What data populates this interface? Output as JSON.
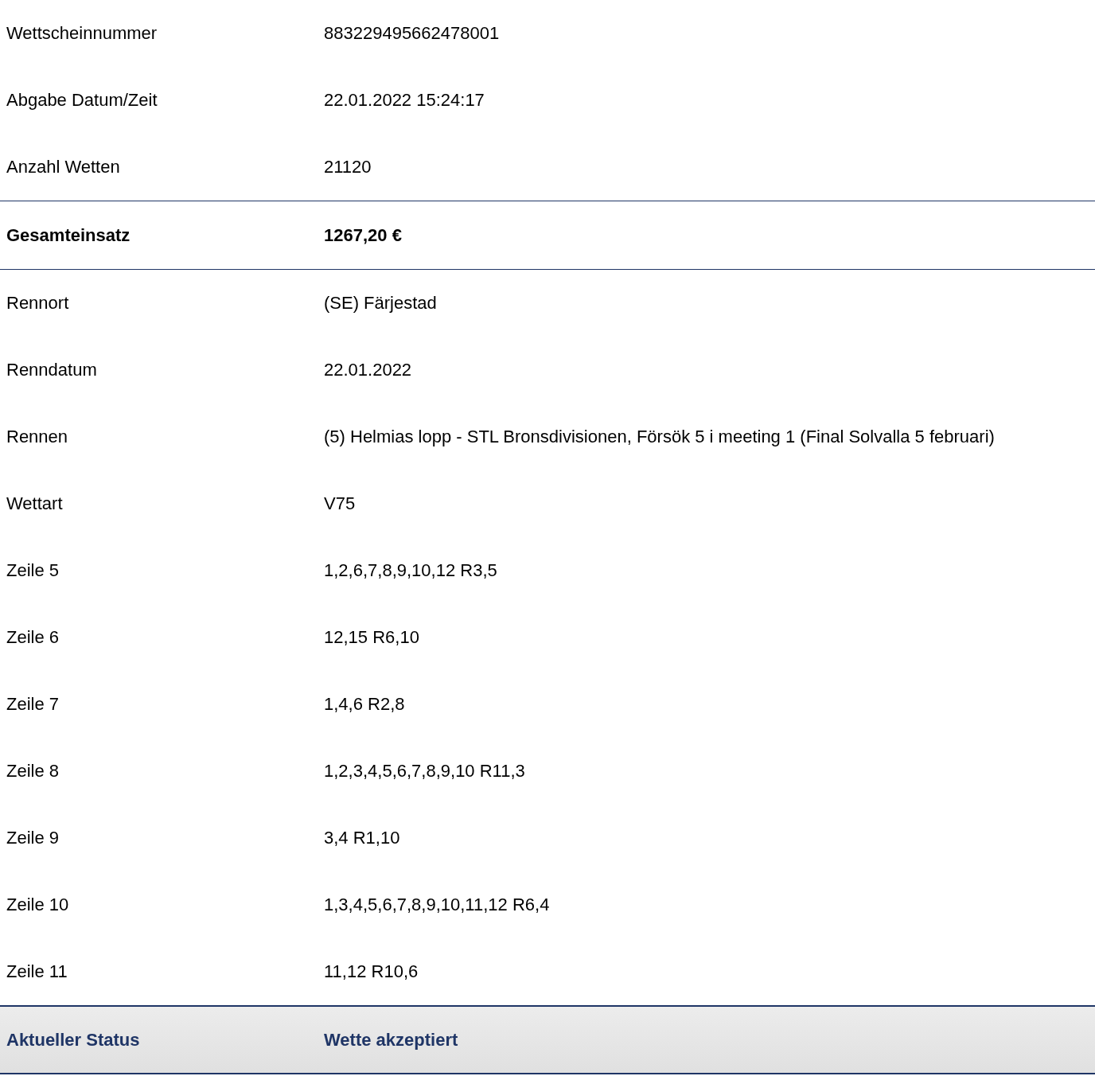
{
  "rows": [
    {
      "kind": "plain",
      "label": "Wettscheinnummer",
      "value": "883229495662478001"
    },
    {
      "kind": "plain",
      "label": "Abgabe Datum/Zeit",
      "value": "22.01.2022 15:24:17"
    },
    {
      "kind": "plain",
      "label": "Anzahl Wetten",
      "value": "21120"
    },
    {
      "kind": "total",
      "label": "Gesamteinsatz",
      "value": "1267,20 €"
    },
    {
      "kind": "plain",
      "label": "Rennort",
      "value": "(SE) Färjestad"
    },
    {
      "kind": "plain",
      "label": "Renndatum",
      "value": "22.01.2022"
    },
    {
      "kind": "plain",
      "label": "Rennen",
      "value": "(5) Helmias lopp - STL Bronsdivisionen, Försök 5 i meeting 1 (Final Solvalla 5 februari)"
    },
    {
      "kind": "plain",
      "label": "Wettart",
      "value": "V75"
    },
    {
      "kind": "plain",
      "label": "Zeile 5",
      "value": "1,2,6,7,8,9,10,12 R3,5"
    },
    {
      "kind": "plain",
      "label": "Zeile 6",
      "value": "12,15 R6,10"
    },
    {
      "kind": "plain",
      "label": "Zeile 7",
      "value": "1,4,6 R2,8"
    },
    {
      "kind": "plain",
      "label": "Zeile 8",
      "value": "1,2,3,4,5,6,7,8,9,10 R11,3"
    },
    {
      "kind": "plain",
      "label": "Zeile 9",
      "value": "3,4 R1,10"
    },
    {
      "kind": "plain",
      "label": "Zeile 10",
      "value": "1,3,4,5,6,7,8,9,10,11,12 R6,4"
    },
    {
      "kind": "plain",
      "label": "Zeile 11",
      "value": "11,12 R10,6"
    },
    {
      "kind": "status",
      "label": "Aktueller Status",
      "value": "Wette akzeptiert"
    }
  ]
}
